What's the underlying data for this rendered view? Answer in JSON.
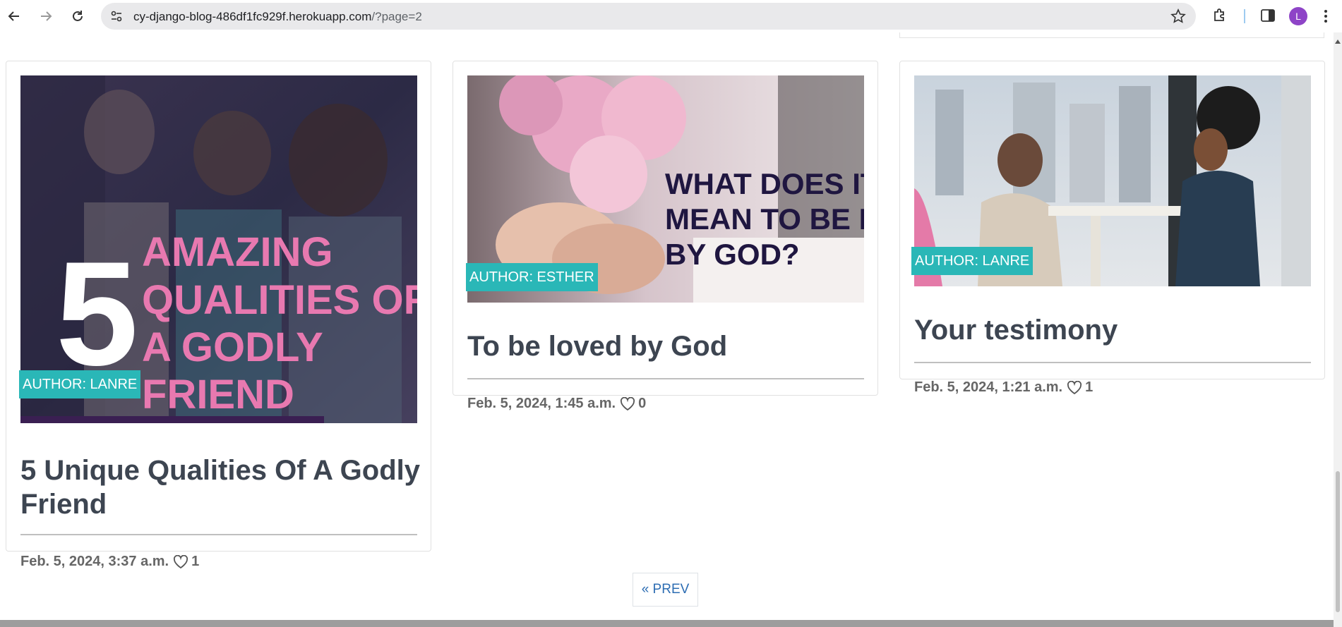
{
  "browser": {
    "url_host": "cy-django-blog-486df1fc929f.herokuapp.com",
    "url_path": "/?page=2",
    "profile_initial": "L"
  },
  "posts": [
    {
      "author_badge": "AUTHOR: LANRE",
      "title": "5 Unique Qualities Of A Godly Friend",
      "date": "Feb. 5, 2024, 3:37 a.m.",
      "likes": "1",
      "image_text": [
        "5",
        "AMAZING",
        "QUALITIES OF",
        "A GODLY",
        "FRIEND"
      ]
    },
    {
      "author_badge": "AUTHOR: ESTHER",
      "title": "To be loved by God",
      "date": "Feb. 5, 2024, 1:45 a.m.",
      "likes": "0",
      "image_text": [
        "WHAT DOES IT",
        "MEAN TO BE LOVED",
        "BY GOD?"
      ]
    },
    {
      "author_badge": "AUTHOR: LANRE",
      "title": "Your testimony",
      "date": "Feb. 5, 2024, 1:21 a.m.",
      "likes": "1"
    }
  ],
  "pagination": {
    "prev_label": "« PREV"
  },
  "colors": {
    "accent_teal": "#2ab7b7",
    "link_blue": "#2d6db3",
    "title_gray": "#3d4551"
  }
}
